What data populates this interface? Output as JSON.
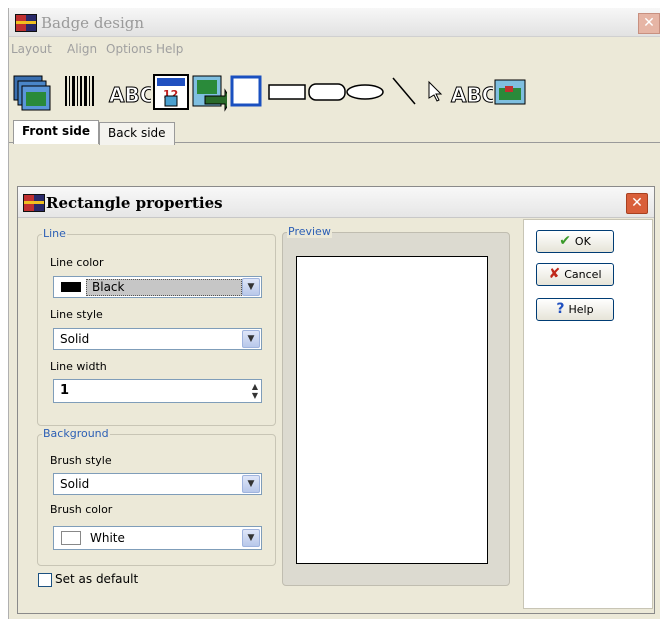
{
  "main_window": {
    "title": "Badge design",
    "menu": [
      "Layout",
      "Align",
      "Options",
      "Help"
    ],
    "toolbar_icons": [
      "image-stack-icon",
      "barcode-icon",
      "abc-text-icon",
      "calendar-date-icon",
      "photo-import-icon",
      "square-icon",
      "rectangle-icon",
      "rounded-rectangle-icon",
      "ellipse-icon",
      "line-icon",
      "pointer-icon",
      "abc-outline-icon",
      "picture-icon"
    ],
    "tabs": [
      {
        "label": "Front side",
        "active": true
      },
      {
        "label": "Back side",
        "active": false
      }
    ]
  },
  "dialog": {
    "title": "Rectangle properties",
    "line_group": {
      "legend": "Line",
      "line_color_label": "Line color",
      "line_color_value": "Black",
      "line_color_swatch": "#000000",
      "line_style_label": "Line style",
      "line_style_value": "Solid",
      "line_width_label": "Line width",
      "line_width_value": "1"
    },
    "background_group": {
      "legend": "Background",
      "brush_style_label": "Brush style",
      "brush_style_value": "Solid",
      "brush_color_label": "Brush color",
      "brush_color_value": "White",
      "brush_color_swatch": "#ffffff"
    },
    "set_default_label": "Set as default",
    "set_default_checked": false,
    "preview_legend": "Preview",
    "buttons": {
      "ok": "OK",
      "cancel": "Cancel",
      "help": "Help"
    }
  },
  "colors": {
    "legend_blue": "#2c5fb5",
    "selection_highlight": "#c6c6c6",
    "ok_green": "#3a9a2a",
    "cancel_red": "#c0281a",
    "help_blue": "#2050c0"
  }
}
